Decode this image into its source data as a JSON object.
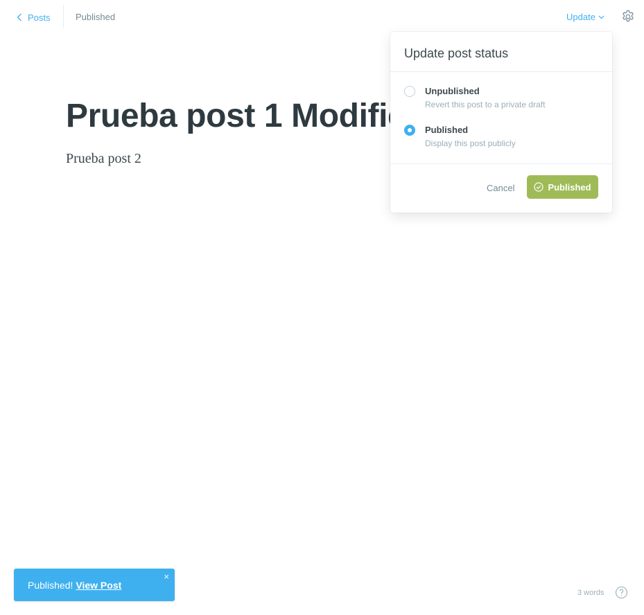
{
  "header": {
    "back_label": "Posts",
    "status": "Published",
    "update_label": "Update",
    "back_icon": "chevron-left-icon",
    "update_icon": "chevron-down-icon",
    "settings_icon": "gear-icon"
  },
  "editor": {
    "title": "Prueba post 1 Modificado",
    "body": "Prueba post 2"
  },
  "status_menu": {
    "heading": "Update post status",
    "options": [
      {
        "title": "Unpublished",
        "description": "Revert this post to a private draft",
        "selected": false
      },
      {
        "title": "Published",
        "description": "Display this post publicly",
        "selected": true
      }
    ],
    "cancel_label": "Cancel",
    "confirm_label": "Published",
    "confirm_icon": "check-circle-icon"
  },
  "notification": {
    "message": "Published!",
    "link_label": "View Post",
    "close_glyph": "×"
  },
  "footer": {
    "word_count": "3 words",
    "help_icon": "help-icon"
  },
  "colors": {
    "accent": "#3eb0ef",
    "publish_green": "#9fbb58",
    "title_text": "#2e3a40",
    "muted_text": "#9baeb8"
  }
}
